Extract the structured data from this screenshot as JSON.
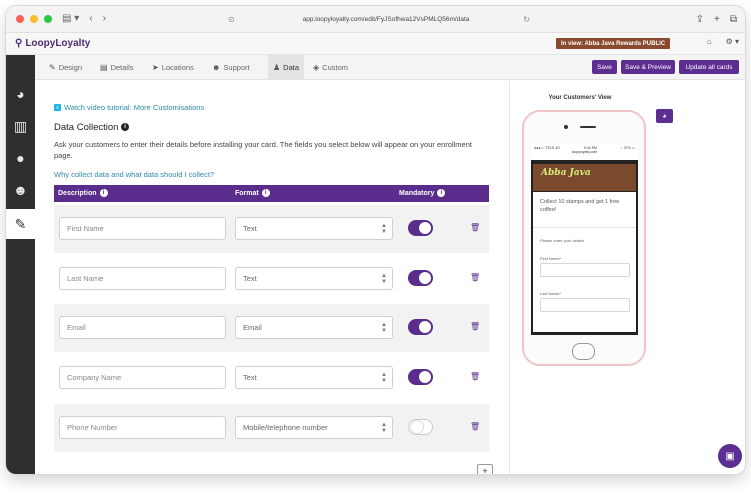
{
  "browser": {
    "url": "app.loopyloyalty.com/edit/FyJSofhwa12VsPMLQ56m/data",
    "icons": [
      "sidebar-icon",
      "back-icon",
      "forward-icon",
      "share-icon",
      "new-tab-icon",
      "tabs-icon"
    ]
  },
  "app": {
    "brand": "LoopyLoyalty",
    "in_view": "In view: Abba Java Rewards PUBLIC"
  },
  "tabs": [
    {
      "label": "Design",
      "icon": "brush-icon"
    },
    {
      "label": "Details",
      "icon": "document-icon"
    },
    {
      "label": "Locations",
      "icon": "location-arrow-icon"
    },
    {
      "label": "Support",
      "icon": "users-icon"
    },
    {
      "label": "Data",
      "icon": "user-icon",
      "active": true
    },
    {
      "label": "Custom",
      "icon": "tag-icon"
    }
  ],
  "actions": {
    "save": "Save",
    "save_preview": "Save & Preview",
    "update_all": "Update all cards"
  },
  "main": {
    "video_link": "Watch video tutorial: More Customisations",
    "heading": "Data Collection",
    "description": "Ask your customers to enter their details before installing your card. The fields you select below will appear on your enrollment page.",
    "why_link": "Why collect data and what data should I collect?",
    "columns": {
      "description": "Description",
      "format": "Format",
      "mandatory": "Mandatory"
    },
    "rows": [
      {
        "placeholder": "First Name",
        "format": "Text",
        "mandatory": true
      },
      {
        "placeholder": "Last Name",
        "format": "Text",
        "mandatory": true
      },
      {
        "placeholder": "Email",
        "format": "Email",
        "mandatory": true
      },
      {
        "placeholder": "Company Name",
        "format": "Text",
        "mandatory": true
      },
      {
        "placeholder": "Phone Number",
        "format": "Mobile/telephone number",
        "mandatory": false
      }
    ],
    "add_label": "+"
  },
  "preview": {
    "title": "Your Customers' View",
    "logo_text": "Abba Java",
    "status_left": "●●●○○ TELS 4G",
    "status_time": "9:44 PM",
    "status_right": "↑ 37% ▭",
    "site": "loopyloyalty.com",
    "card_text": "Collect 10 stamps and get 1 free coffee!",
    "form_prompt": "Please enter your details",
    "field1_label": "First Name*",
    "field2_label": "Last Name*"
  },
  "colors": {
    "primary": "#5c2e91",
    "badge": "#8a4a2e",
    "link": "#2d8ba8"
  }
}
